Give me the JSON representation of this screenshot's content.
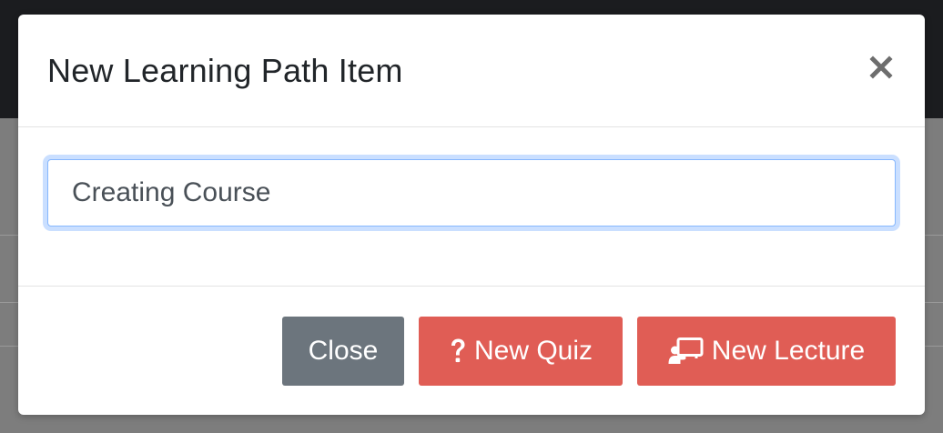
{
  "modal": {
    "title": "New Learning Path Item",
    "close_icon": "close-icon"
  },
  "form": {
    "item_input_value": "Creating Course"
  },
  "footer": {
    "close_label": "Close",
    "new_quiz_label": "New Quiz",
    "new_quiz_icon": "question-icon",
    "new_lecture_label": "New Lecture",
    "new_lecture_icon": "presentation-icon"
  },
  "colors": {
    "danger_button": "#e05d55",
    "secondary_button": "#6c757d",
    "input_focus_border": "#86b7fe",
    "backdrop": "#7d7d7d",
    "topbar": "#1b1c1f"
  }
}
